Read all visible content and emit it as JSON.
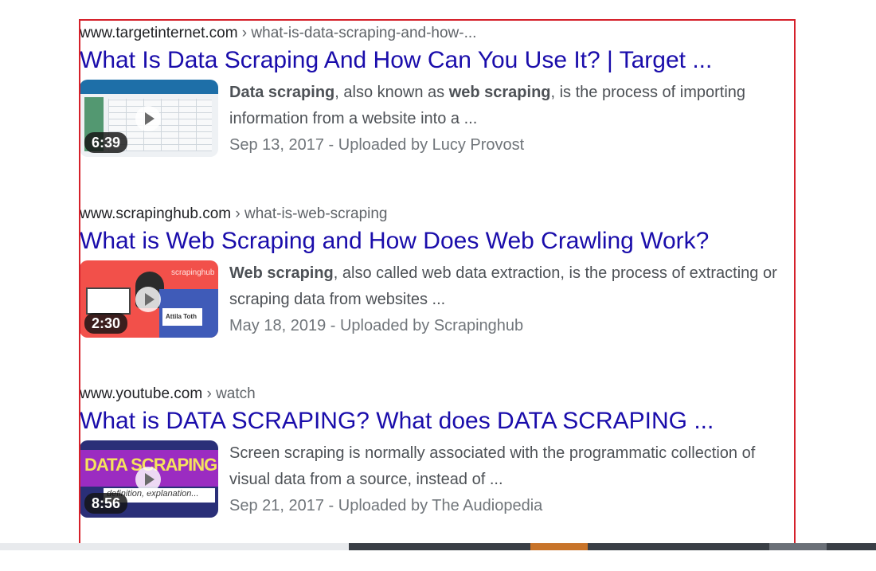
{
  "results": [
    {
      "domain": "www.targetinternet.com",
      "path": " › what-is-data-scraping-and-how-...",
      "title": "What Is Data Scraping And How Can You Use It? | Target ...",
      "snippet_bold1": "Data scraping",
      "snippet_mid": ", also known as ",
      "snippet_bold2": "web scraping",
      "snippet_rest": ", is the process of importing information from a website into a ...",
      "meta": "Sep 13, 2017 - Uploaded by Lucy Provost",
      "duration": "6:39"
    },
    {
      "domain": "www.scrapinghub.com",
      "path": " › what-is-web-scraping",
      "title": "What is Web Scraping and How Does Web Crawling Work?",
      "snippet_bold1": "Web scraping",
      "snippet_rest": ", also called web data extraction, is the process of extracting or scraping data from websites ...",
      "meta": "May 18, 2019 - Uploaded by Scrapinghub",
      "duration": "2:30",
      "thumb_brand": "scrapinghub",
      "thumb_label": "Attila Toth"
    },
    {
      "domain": "www.youtube.com",
      "path": " › watch",
      "title": "What is DATA SCRAPING? What does DATA SCRAPING ...",
      "snippet_plain": "Screen scraping is normally associated with the programmatic collection of visual data from a source, instead of ...",
      "meta": "Sep 21, 2017 - Uploaded by The Audiopedia",
      "duration": "8:56",
      "thumb_word": "DATA SCRAPING",
      "thumb_sub": "definition, explanation..."
    }
  ],
  "colors": {
    "title_link": "#1a0dab",
    "cite": "#202124",
    "snippet": "#4d5156",
    "meta": "#70757a",
    "frame": "#d5202a"
  }
}
